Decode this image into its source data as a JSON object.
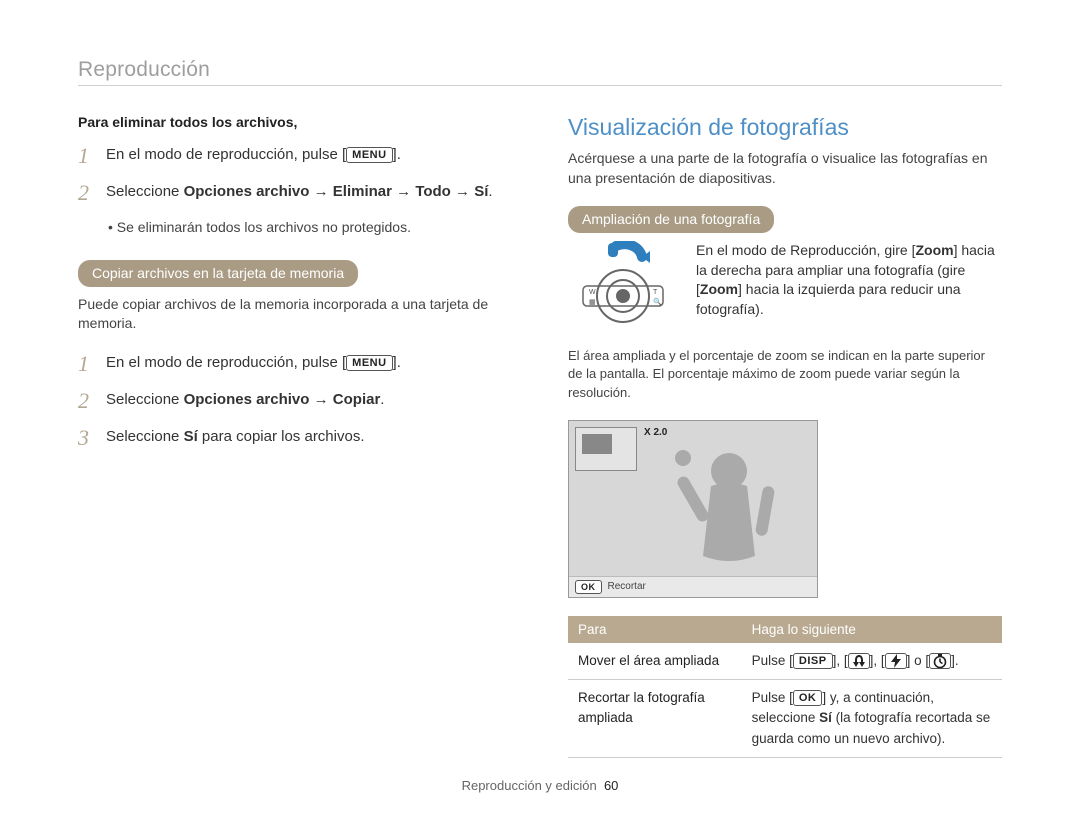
{
  "header": {
    "title": "Reproducción"
  },
  "left": {
    "deleteAll": {
      "heading": "Para eliminar todos los archivos,",
      "step1_pre": "En el modo de reproducción, pulse [",
      "step1_post": "].",
      "step2_pre": "Seleccione ",
      "step2_bold1": "Opciones archivo",
      "step2_arrow1": " → ",
      "step2_bold2": "Eliminar",
      "step2_arrow2": " → ",
      "step2_bold3": "Todo",
      "step2_arrow3": " → ",
      "step2_bold4": "Sí",
      "step2_post": ".",
      "bullet": "Se eliminarán todos los archivos no protegidos."
    },
    "copy": {
      "pill": "Copiar archivos en la tarjeta de memoria",
      "desc": "Puede copiar archivos de la memoria incorporada a una tarjeta de memoria.",
      "step1_pre": "En el modo de reproducción, pulse [",
      "step1_post": "].",
      "step2_pre": "Seleccione ",
      "step2_bold1": "Opciones archivo",
      "step2_arrow1": " → ",
      "step2_bold2": "Copiar",
      "step2_post": ".",
      "step3_pre": "Seleccione ",
      "step3_bold": "Sí",
      "step3_post": " para copiar los archivos."
    }
  },
  "right": {
    "title": "Visualización de fotografías",
    "intro": "Acérquese a una parte de la fotografía o visualice las fotografías en una presentación de diapositivas.",
    "pill": "Ampliación de una fotografía",
    "zoom_text_pre": "En el modo de Reproducción, gire [",
    "zoom_bold1": "Zoom",
    "zoom_text_mid": "] hacia la derecha para ampliar una fotografía (gire [",
    "zoom_bold2": "Zoom",
    "zoom_text_post": "] hacia la izquierda para reducir una fotografía).",
    "note": "El área ampliada y el porcentaje de zoom se indican en la parte superior de la pantalla. El porcentaje máximo de zoom puede variar según la resolución.",
    "preview_zoom": "X 2.0",
    "preview_crop": "Recortar",
    "table": {
      "h1": "Para",
      "h2": "Haga lo siguiente",
      "r1c1": "Mover el área ampliada",
      "r1c2_pre": "Pulse [",
      "r1c2_sep": "], [",
      "r1c2_or": "] o [",
      "r1c2_post": "].",
      "r2c1": "Recortar la fotografía ampliada",
      "r2c2_pre": "Pulse [",
      "r2c2_mid": "] y, a continuación, seleccione ",
      "r2c2_bold": "Sí",
      "r2c2_post": " (la fotografía recortada se guarda como un nuevo archivo)."
    }
  },
  "buttons": {
    "menu": "MENU",
    "disp": "DISP",
    "ok": "OK"
  },
  "footer": {
    "section": "Reproducción y edición",
    "page": "60"
  }
}
